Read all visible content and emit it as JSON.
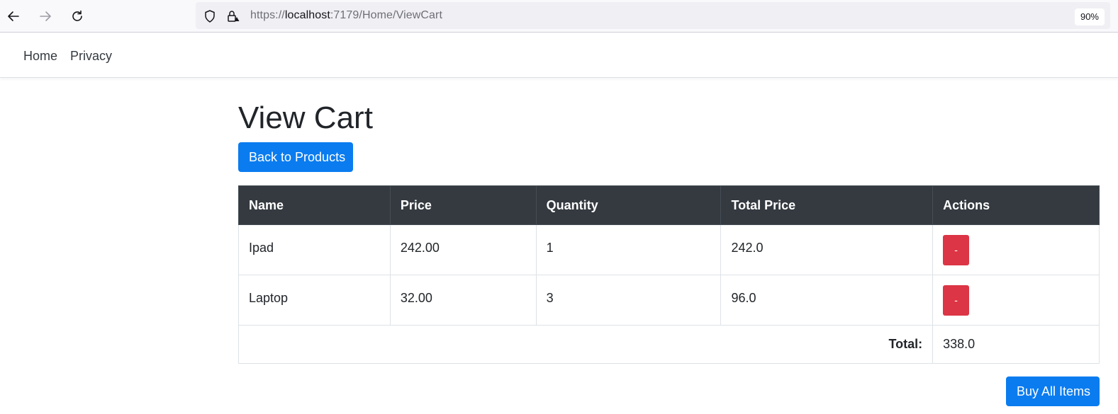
{
  "browser": {
    "url_scheme": "https://",
    "url_host": "localhost",
    "url_rest": ":7179/Home/ViewCart",
    "zoom": "90%",
    "icons": [
      "back-arrow-icon",
      "forward-arrow-icon",
      "reload-icon",
      "shield-icon",
      "lock-warning-icon"
    ]
  },
  "navbar": {
    "links": [
      "Home",
      "Privacy"
    ]
  },
  "page": {
    "title": "View Cart",
    "back_button": "Back to Products",
    "buy_button": "Buy All Items"
  },
  "cart": {
    "columns": [
      "Name",
      "Price",
      "Quantity",
      "Total Price",
      "Actions"
    ],
    "rows": [
      {
        "name": "Ipad",
        "price": "242.00",
        "quantity": "1",
        "total_price": "242.0",
        "action": "-"
      },
      {
        "name": "Laptop",
        "price": "32.00",
        "quantity": "3",
        "total_price": "96.0",
        "action": "-"
      }
    ],
    "total_label": "Total:",
    "total_value": "338.0"
  },
  "colors": {
    "primary": "#0a7cf0",
    "danger": "#dc3545",
    "table_header": "#343a40"
  }
}
